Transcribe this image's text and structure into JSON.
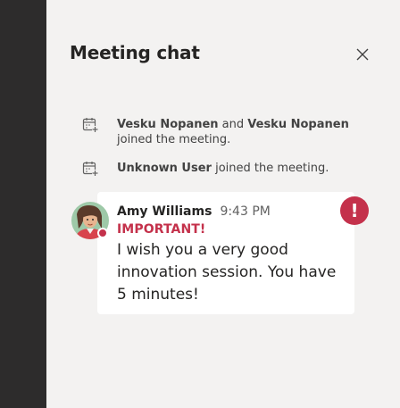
{
  "panel": {
    "title": "Meeting chat"
  },
  "events": [
    {
      "icon": "calendar-add-icon",
      "actor1": "Vesku Nopanen",
      "connector": " and ",
      "actor2": "Vesku Nopanen",
      "action": "joined the meeting."
    },
    {
      "icon": "calendar-add-icon",
      "actor1": "Unknown User",
      "action": " joined the meeting."
    }
  ],
  "message": {
    "sender": "Amy Williams",
    "time": "9:43 PM",
    "importance_label": "IMPORTANT!",
    "body": "I wish you a very good innovation session. You have 5 minutes!",
    "importance_glyph": "!",
    "presence": "busy"
  },
  "colors": {
    "rail": "#2d2c2c",
    "panel_bg": "#f3f2f1",
    "important": "#c4314b",
    "bubble_bg": "#ffffff"
  }
}
